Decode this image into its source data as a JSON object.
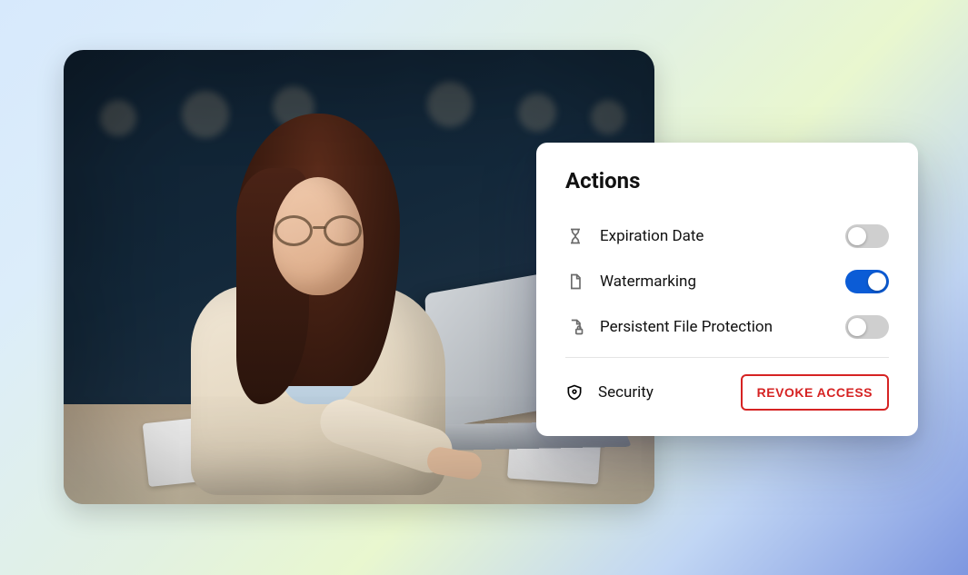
{
  "card": {
    "title": "Actions",
    "rows": [
      {
        "label": "Expiration Date",
        "on": false
      },
      {
        "label": "Watermarking",
        "on": true
      },
      {
        "label": "Persistent File Protection",
        "on": false
      }
    ],
    "security_label": "Security",
    "revoke_label": "REVOKE ACCESS"
  },
  "colors": {
    "toggle_on": "#0b5cd6",
    "danger": "#d62323"
  }
}
